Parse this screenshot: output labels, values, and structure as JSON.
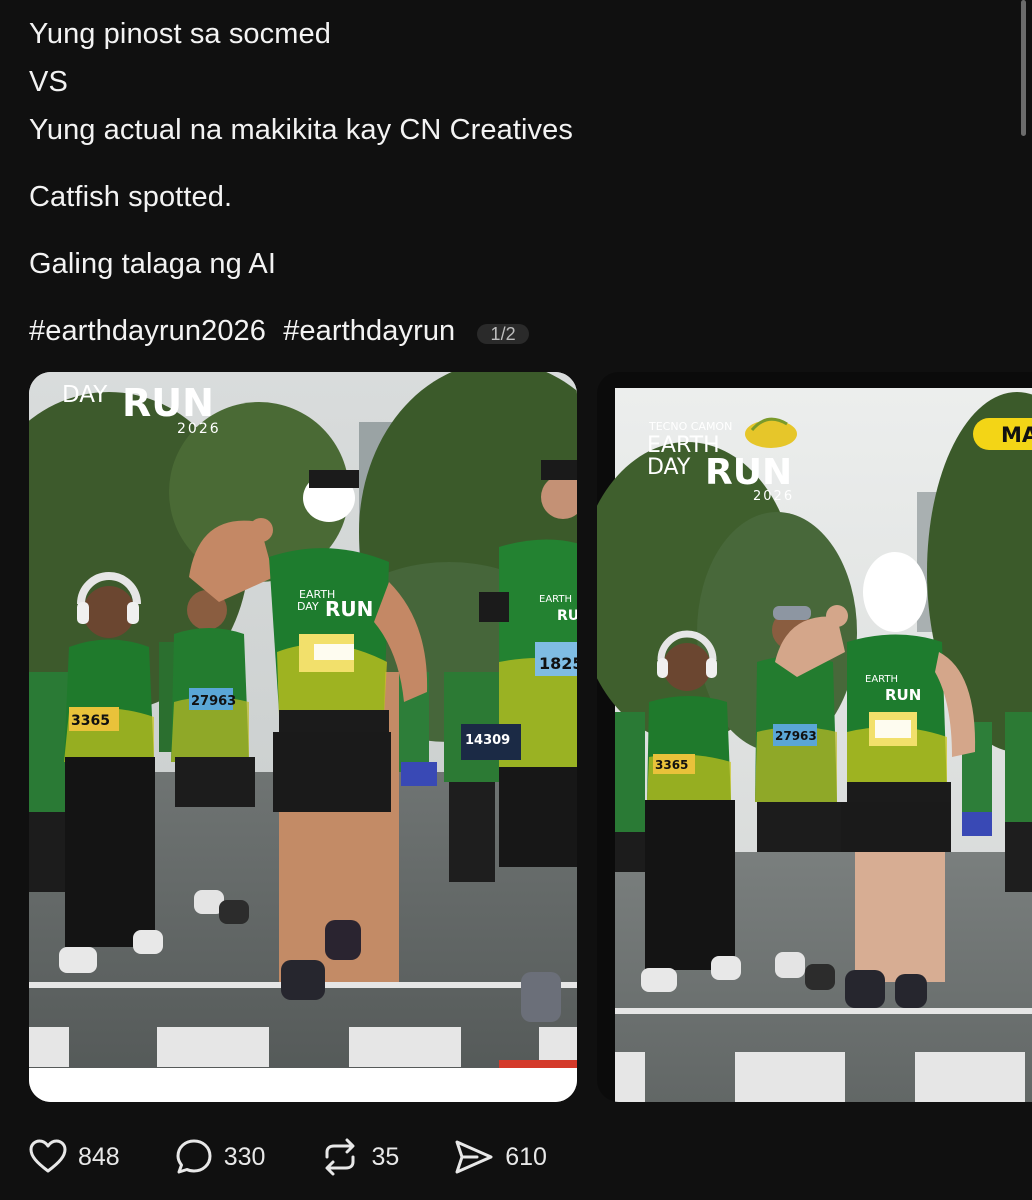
{
  "post": {
    "lines": [
      "Yung pinost sa socmed",
      "VS",
      "Yung actual na makikita kay CN Creatives",
      "Catfish spotted.",
      "Galing talaga ng AI"
    ],
    "hashtags": [
      "#earthdayrun2026",
      "#earthdayrun"
    ]
  },
  "carousel": {
    "counter": "1/2",
    "photo1": {
      "logo_top": "DAY",
      "logo_run": "RUN",
      "logo_year": "2026",
      "shirt_logo_top": "EARTH",
      "shirt_logo_mid": "DAY",
      "shirt_logo_run": "RUN",
      "bib_1": "3365",
      "bib_2": "27963",
      "bib_3": "14309",
      "bib_4": "1825"
    },
    "photo2": {
      "brand": "TECNO CAMON",
      "logo_top": "EARTH",
      "logo_mid": "DAY",
      "logo_run": "RUN",
      "logo_year": "2026",
      "badge": "MA",
      "bib_1": "3365",
      "bib_2": "27963"
    }
  },
  "actions": {
    "likes": "848",
    "replies": "330",
    "reposts": "35",
    "shares": "610"
  },
  "colors": {
    "background": "#101010",
    "text": "#f3f3f3",
    "jersey_green": "#1f7a2c",
    "jersey_yellow": "#c9c51d",
    "badge_yellow": "#f3d516"
  }
}
